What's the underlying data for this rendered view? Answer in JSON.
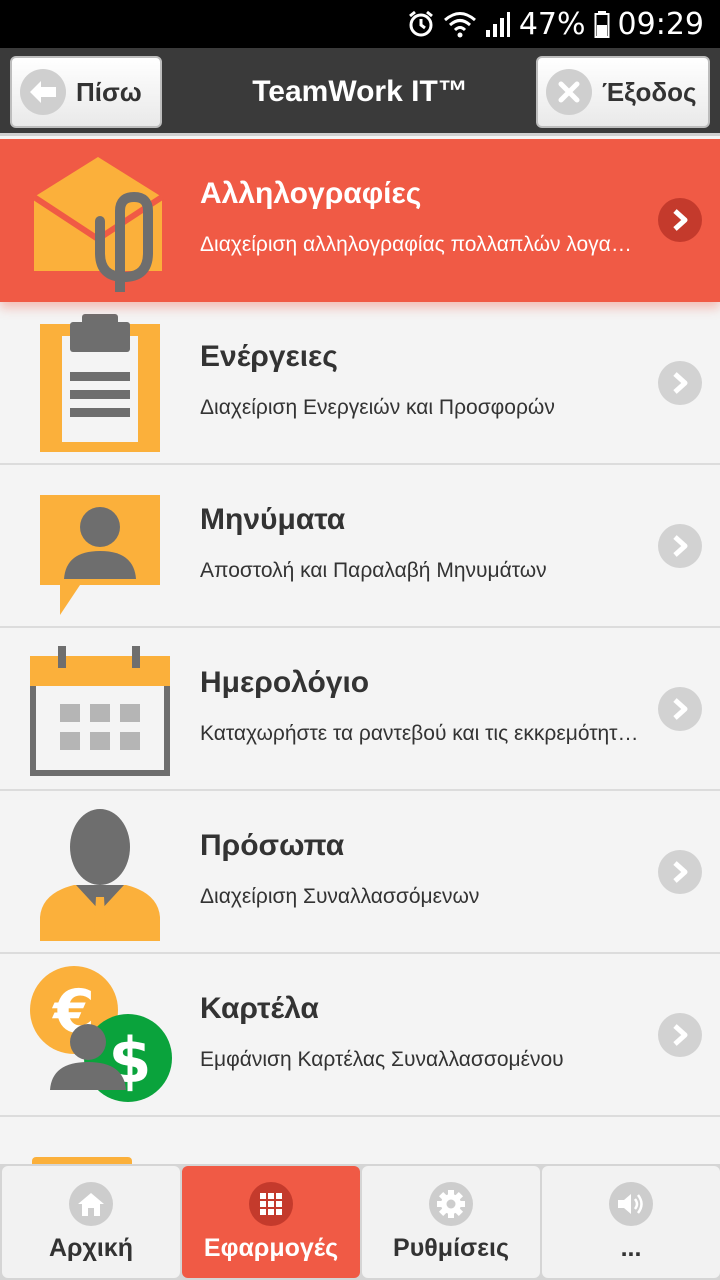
{
  "status_bar": {
    "battery": "47%",
    "time": "09:29",
    "icons": [
      "alarm-icon",
      "wifi-icon",
      "signal-icon",
      "battery-icon"
    ]
  },
  "header": {
    "title": "TeamWork IT™",
    "back_label": "Πίσω",
    "exit_label": "Έξοδος"
  },
  "items": [
    {
      "title": "Αλληλογραφίες",
      "subtitle": "Διαχείριση αλληλογραφίας πολλαπλών λογαριασμών",
      "icon": "mail-attachment-icon",
      "active": true
    },
    {
      "title": "Ενέργειες",
      "subtitle": "Διαχείριση Ενεργειών και Προσφορών",
      "icon": "clipboard-icon",
      "active": false
    },
    {
      "title": "Μηνύματα",
      "subtitle": "Αποστολή και Παραλαβή Μηνυμάτων",
      "icon": "message-person-icon",
      "active": false
    },
    {
      "title": "Ημερολόγιο",
      "subtitle": "Καταχωρήστε τα ραντεβού και τις εκκρεμότητές σας",
      "icon": "calendar-icon",
      "active": false
    },
    {
      "title": "Πρόσωπα",
      "subtitle": "Διαχείριση Συναλλασσόμενων",
      "icon": "person-icon",
      "active": false
    },
    {
      "title": "Καρτέλα",
      "subtitle": "Εμφάνιση Καρτέλας Συναλλασσομένου",
      "icon": "currency-person-icon",
      "active": false
    },
    {
      "title": "",
      "subtitle": "",
      "icon": "folder-icon",
      "active": false
    }
  ],
  "bottom_nav": [
    {
      "label": "Αρχική",
      "icon": "home-icon",
      "active": false
    },
    {
      "label": "Εφαρμογές",
      "icon": "grid-icon",
      "active": true
    },
    {
      "label": "Ρυθμίσεις",
      "icon": "gear-icon",
      "active": false
    },
    {
      "label": "...",
      "icon": "speaker-icon",
      "active": false
    }
  ],
  "colors": {
    "accent": "#f05a45",
    "accent_dark": "#c43a2c",
    "icon_orange": "#fbb03b",
    "icon_gray": "#6e6e6e",
    "header_bg": "#3a3a3a",
    "money_green": "#0aa33c"
  }
}
